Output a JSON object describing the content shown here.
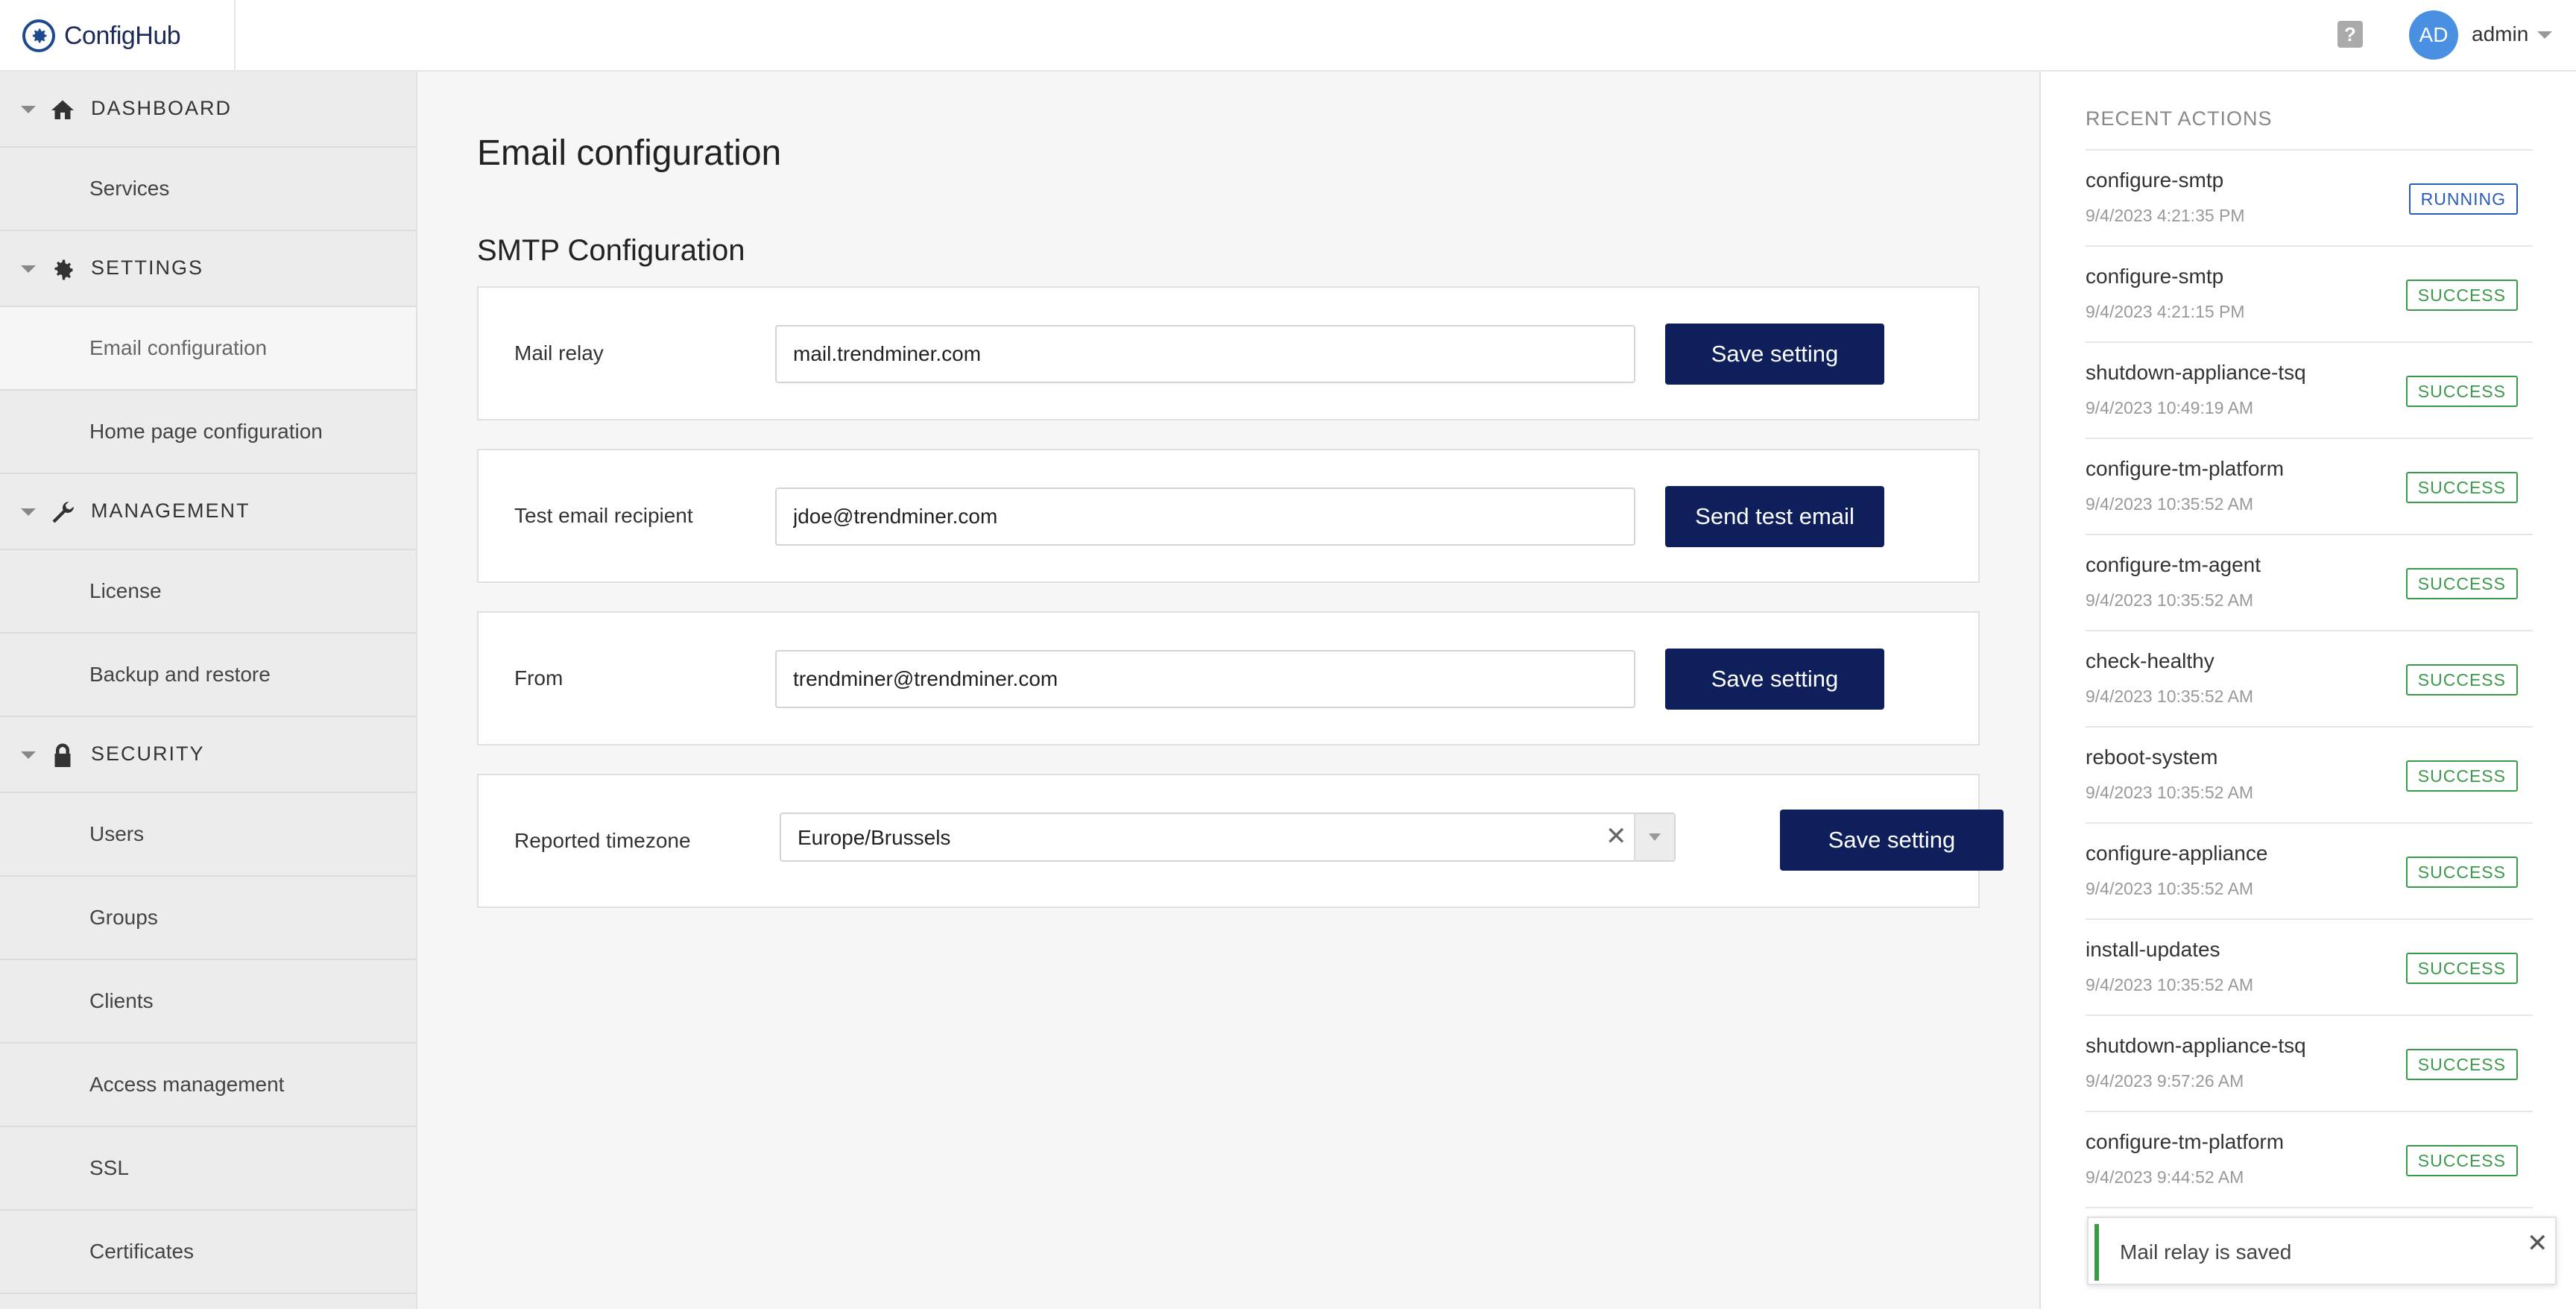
{
  "app": {
    "name": "ConfigHub"
  },
  "header": {
    "help_icon": "help-icon",
    "user_initials": "AD",
    "user_name": "admin"
  },
  "sidebar": {
    "sections": [
      {
        "label": "DASHBOARD",
        "icon": "home-icon",
        "items": [
          {
            "label": "Services"
          }
        ]
      },
      {
        "label": "SETTINGS",
        "icon": "gear-icon",
        "items": [
          {
            "label": "Email configuration",
            "active": true
          },
          {
            "label": "Home page configuration"
          }
        ]
      },
      {
        "label": "MANAGEMENT",
        "icon": "wrench-icon",
        "items": [
          {
            "label": "License"
          },
          {
            "label": "Backup and restore"
          }
        ]
      },
      {
        "label": "SECURITY",
        "icon": "lock-icon",
        "items": [
          {
            "label": "Users"
          },
          {
            "label": "Groups"
          },
          {
            "label": "Clients"
          },
          {
            "label": "Access management"
          },
          {
            "label": "SSL"
          },
          {
            "label": "Certificates"
          }
        ]
      }
    ]
  },
  "main": {
    "title": "Email configuration",
    "section_title": "SMTP Configuration",
    "mail_relay": {
      "label": "Mail relay",
      "value": "mail.trendminer.com",
      "button": "Save setting"
    },
    "test_email": {
      "label": "Test email recipient",
      "value": "jdoe@trendminer.com",
      "button": "Send test email"
    },
    "from": {
      "label": "From",
      "value": "trendminer@trendminer.com",
      "button": "Save setting"
    },
    "timezone": {
      "label": "Reported timezone",
      "value": "Europe/Brussels",
      "button": "Save setting"
    }
  },
  "recent_actions": {
    "title": "RECENT ACTIONS",
    "items": [
      {
        "name": "configure-smtp",
        "time": "9/4/2023 4:21:35 PM",
        "status": "RUNNING"
      },
      {
        "name": "configure-smtp",
        "time": "9/4/2023 4:21:15 PM",
        "status": "SUCCESS"
      },
      {
        "name": "shutdown-appliance-tsq",
        "time": "9/4/2023 10:49:19 AM",
        "status": "SUCCESS"
      },
      {
        "name": "configure-tm-platform",
        "time": "9/4/2023 10:35:52 AM",
        "status": "SUCCESS"
      },
      {
        "name": "configure-tm-agent",
        "time": "9/4/2023 10:35:52 AM",
        "status": "SUCCESS"
      },
      {
        "name": "check-healthy",
        "time": "9/4/2023 10:35:52 AM",
        "status": "SUCCESS"
      },
      {
        "name": "reboot-system",
        "time": "9/4/2023 10:35:52 AM",
        "status": "SUCCESS"
      },
      {
        "name": "configure-appliance",
        "time": "9/4/2023 10:35:52 AM",
        "status": "SUCCESS"
      },
      {
        "name": "install-updates",
        "time": "9/4/2023 10:35:52 AM",
        "status": "SUCCESS"
      },
      {
        "name": "shutdown-appliance-tsq",
        "time": "9/4/2023 9:57:26 AM",
        "status": "SUCCESS"
      },
      {
        "name": "configure-tm-platform",
        "time": "9/4/2023 9:44:52 AM",
        "status": "SUCCESS"
      }
    ]
  },
  "toast": {
    "message": "Mail relay is saved",
    "close_icon": "close-icon"
  },
  "colors": {
    "primary": "#0e1f5b",
    "success": "#3a9a4a",
    "running": "#2a5bb8",
    "avatar": "#4a90e2"
  }
}
